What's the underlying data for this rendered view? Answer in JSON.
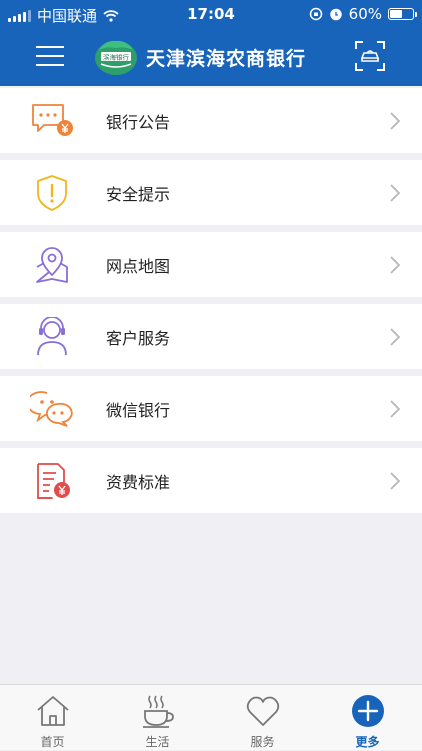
{
  "status_bar": {
    "carrier": "中国联通",
    "time": "17:04",
    "battery": "60%",
    "battery_level": 0.6
  },
  "header": {
    "logo_text": "滨海银行",
    "title": "天津滨海农商银行",
    "menu_icon": "hamburger-icon",
    "scan_icon": "scan-icon"
  },
  "menu": {
    "items": [
      {
        "label": "银行公告",
        "icon": "announcement-icon",
        "color": "#f0833a"
      },
      {
        "label": "安全提示",
        "icon": "shield-alert-icon",
        "color": "#f2b51b"
      },
      {
        "label": "网点地图",
        "icon": "map-pin-icon",
        "color": "#8a6fd8"
      },
      {
        "label": "客户服务",
        "icon": "headset-user-icon",
        "color": "#8a6fd8"
      },
      {
        "label": "微信银行",
        "icon": "wechat-icon",
        "color": "#f0833a"
      },
      {
        "label": "资费标准",
        "icon": "fee-document-icon",
        "color": "#e24c4c"
      }
    ]
  },
  "tabbar": {
    "tabs": [
      {
        "label": "首页",
        "icon": "home-icon",
        "active": false
      },
      {
        "label": "生活",
        "icon": "coffee-cup-icon",
        "active": false
      },
      {
        "label": "服务",
        "icon": "heart-icon",
        "active": false
      },
      {
        "label": "更多",
        "icon": "plus-circle-icon",
        "active": true
      }
    ]
  },
  "colors": {
    "brand_blue": "#1864ba",
    "background": "#efeff4"
  }
}
